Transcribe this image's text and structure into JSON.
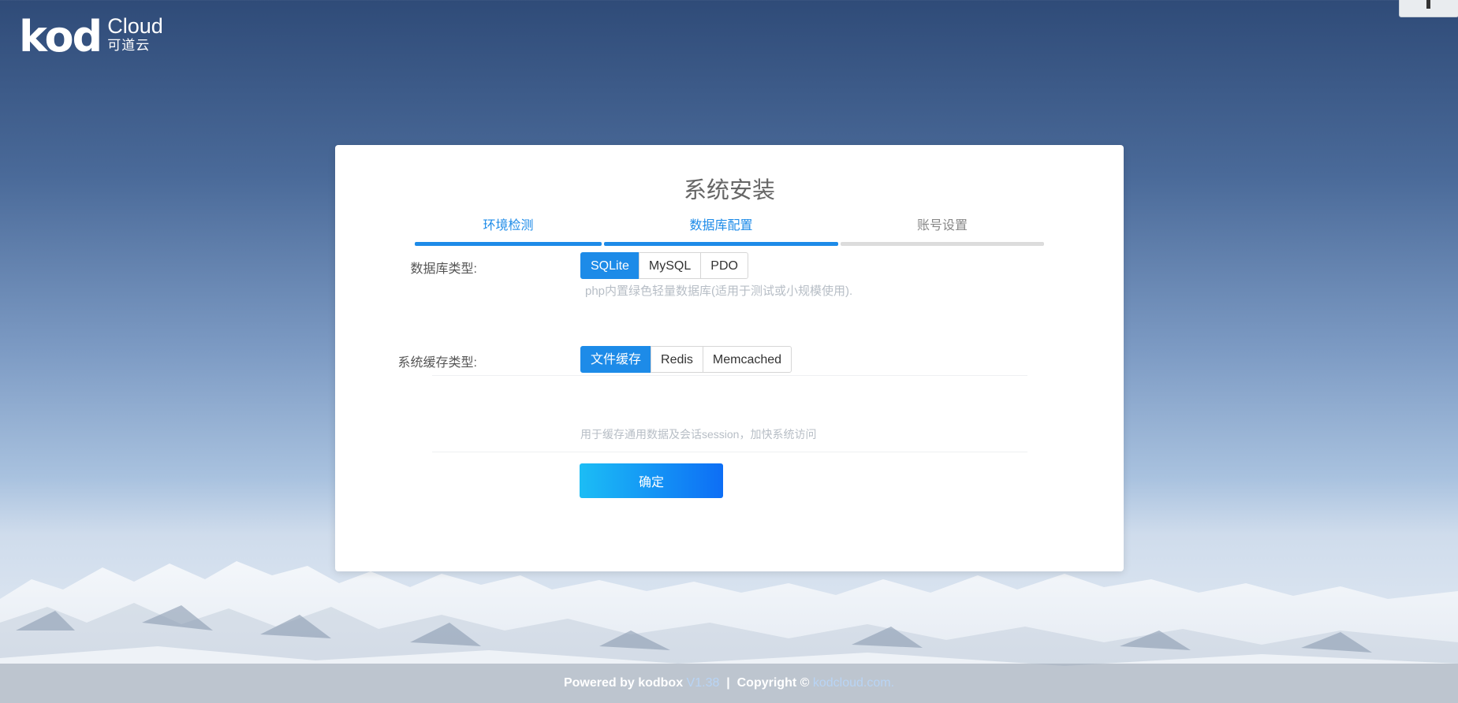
{
  "logo": {
    "mark": "kod",
    "english": "Cloud",
    "chinese": "可道云"
  },
  "install": {
    "title": "系统安装",
    "steps": [
      {
        "label": "环境检测",
        "status": "done"
      },
      {
        "label": "数据库配置",
        "status": "done"
      },
      {
        "label": "账号设置",
        "status": "pending"
      }
    ],
    "db": {
      "label": "数据库类型:",
      "options": [
        "SQLite",
        "MySQL",
        "PDO"
      ],
      "selected": "SQLite",
      "hint": "php内置绿色轻量数据库(适用于测试或小规模使用)."
    },
    "cache": {
      "label": "系统缓存类型:",
      "options": [
        "文件缓存",
        "Redis",
        "Memcached"
      ],
      "selected": "文件缓存",
      "hint": "用于缓存通用数据及会话session，加快系统访问"
    },
    "confirm_label": "确定"
  },
  "footer": {
    "powered": "Powered by kodbox",
    "version": "V1.38",
    "separator": "|",
    "copyright": "Copyright ©",
    "link": "kodcloud.com",
    "tail": "."
  },
  "colors": {
    "accent": "#1d8be8",
    "step_pending": "#dcdcdc"
  }
}
